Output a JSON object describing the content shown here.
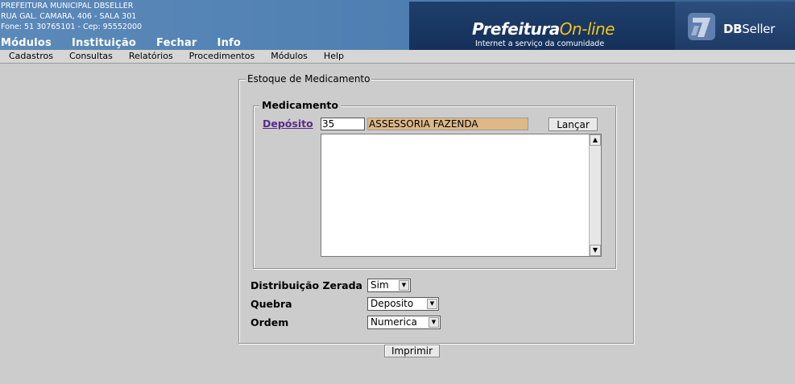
{
  "header": {
    "address_lines": [
      "PREFEITURA MUNICIPAL DBSELLER",
      "RUA GAL. CAMARA, 406 - SALA 301",
      "Fone: 51 30765101  -  Cep: 95552000"
    ],
    "top_menu": [
      "Módulos",
      "Instituição",
      "Fechar",
      "Info"
    ],
    "logo_main": "Prefeitura",
    "logo_accent": "On-line",
    "logo_tagline": "Internet a serviço da comunidade",
    "brand_bold": "DB",
    "brand_rest": "Seller"
  },
  "menubar": [
    "Cadastros",
    "Consultas",
    "Relatórios",
    "Procedimentos",
    "Módulos",
    "Help"
  ],
  "form": {
    "title": "Estoque de Medicamento",
    "medicamento_legend": "Medicamento",
    "deposito_label": "Depósito",
    "deposito_code": "35",
    "deposito_desc": "ASSESSORIA FAZENDA",
    "lancar_label": "Lançar",
    "distribuicao_label": "Distribuição Zerada",
    "distribuicao_value": "Sim",
    "quebra_label": "Quebra",
    "quebra_value": "Deposito",
    "ordem_label": "Ordem",
    "ordem_value": "Numerica",
    "imprimir_label": "Imprimir"
  },
  "colors": {
    "banner": "#4f7fb2",
    "readonly_field": "#deb887",
    "link": "#5a2a8a",
    "accent_yellow": "#f5c21b"
  }
}
